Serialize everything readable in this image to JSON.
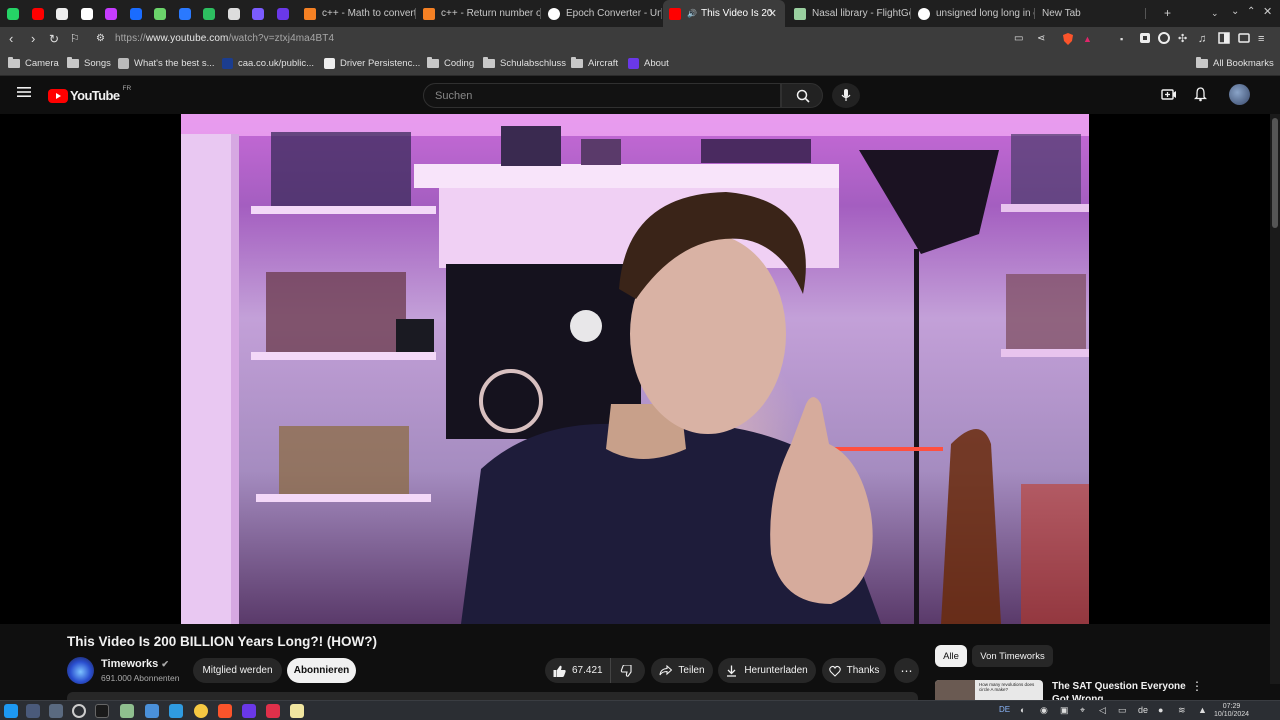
{
  "browser": {
    "pinned_tabs": [
      {
        "name": "whatsapp",
        "color": "#25d366"
      },
      {
        "name": "youtube",
        "color": "#ff0000"
      },
      {
        "name": "notion",
        "color": "#eeeeee"
      },
      {
        "name": "openai",
        "color": "#ffffff"
      },
      {
        "name": "ring",
        "color": "#c63cff"
      },
      {
        "name": "bolt",
        "color": "#1a6cff"
      },
      {
        "name": "pixel",
        "color": "#6bd46b"
      },
      {
        "name": "hook",
        "color": "#2a79ff"
      },
      {
        "name": "evernote",
        "color": "#2dbe60"
      },
      {
        "name": "chatgpt",
        "color": "#dddddd"
      },
      {
        "name": "x-app",
        "color": "#7b5cff"
      },
      {
        "name": "vivaldi-v",
        "color": "#6a38e8"
      }
    ],
    "tabs": [
      {
        "label": "c++ - Math to convert",
        "icon": "stackoverflow-icon",
        "color": "#f48024"
      },
      {
        "label": "c++ - Return number o",
        "icon": "stackoverflow-icon",
        "color": "#f48024"
      },
      {
        "label": "Epoch Converter - Unix",
        "icon": "clock-icon",
        "color": "#ffffff"
      },
      {
        "label": "This Video Is 20",
        "icon": "youtube-icon",
        "color": "#ff0000",
        "active": true
      },
      {
        "label": "Nasal library - FlightGe",
        "icon": "wiki-icon",
        "color": "#9ad0a0"
      },
      {
        "label": "unsigned long long in c",
        "icon": "globe-icon",
        "color": "#ffffff"
      },
      {
        "label": "New Tab",
        "icon": "",
        "color": ""
      }
    ],
    "new_tab_symbol": "+",
    "url_prefix": "https://",
    "url_host": "www.youtube.com",
    "url_path": "/watch?v=ztxj4ma4BT4",
    "bookmarks": [
      {
        "label": "Camera",
        "type": "folder"
      },
      {
        "label": "Songs",
        "type": "folder"
      },
      {
        "label": "What's the best s...",
        "type": "site",
        "color": "#bbbbbb"
      },
      {
        "label": "caa.co.uk/public...",
        "type": "site",
        "color": "#1b3d8f"
      },
      {
        "label": "Driver Persistenc...",
        "type": "site",
        "color": "#eeeeee"
      },
      {
        "label": "Coding",
        "type": "folder"
      },
      {
        "label": "Schulabschluss",
        "type": "folder"
      },
      {
        "label": "Aircraft",
        "type": "folder"
      },
      {
        "label": "About",
        "type": "site",
        "color": "#6a38e8"
      }
    ],
    "all_bookmarks": "All Bookmarks"
  },
  "youtube": {
    "logo_text": "YouTube",
    "logo_region": "FR",
    "search_placeholder": "Suchen",
    "video_title": "This Video Is 200 BILLION Years Long?! (HOW?)",
    "channel_name": "Timeworks",
    "subscribers": "691.000 Abonnenten",
    "join_label": "Mitglied werden",
    "subscribe_label": "Abonnieren",
    "likes": "67.421",
    "share_label": "Teilen",
    "download_label": "Herunterladen",
    "thanks_label": "Thanks",
    "more_label": "⋯",
    "chips": [
      "Alle",
      "Von Timeworks"
    ],
    "rec_title": "The SAT Question Everyone Got Wrong",
    "rec_thumb_text": "How many revolutions does circle A make?",
    "brand_color": "#ff0000"
  },
  "taskbar": {
    "lang": "DE",
    "keyboard": "de",
    "time": "07:29",
    "date": "10/10/2024"
  }
}
